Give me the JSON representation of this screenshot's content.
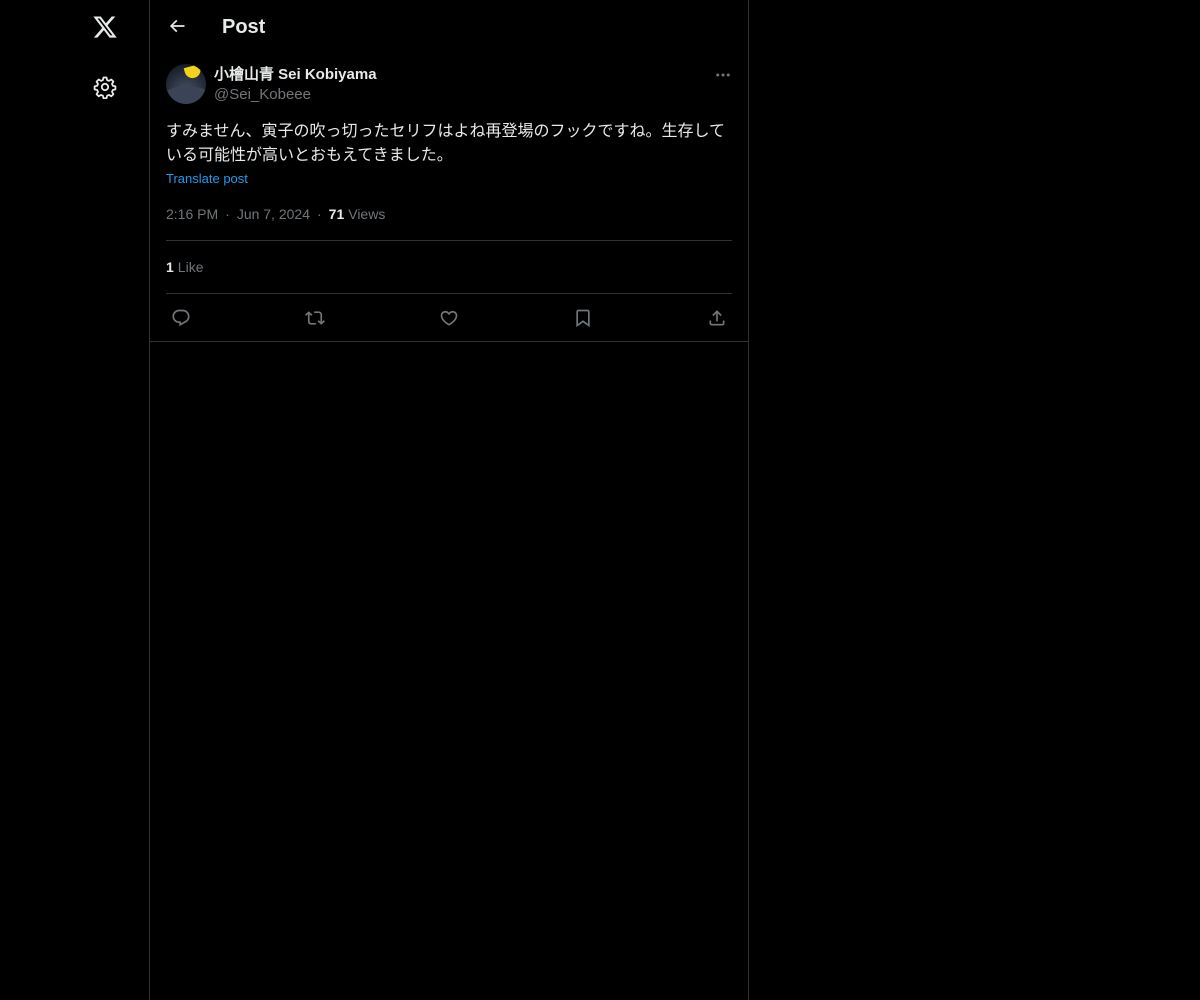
{
  "nav": {
    "logo_icon": "x-logo-icon",
    "settings_icon": "gear-icon"
  },
  "header": {
    "title": "Post",
    "back_icon": "arrow-left-icon"
  },
  "post": {
    "author_name": "小檜山青 Sei Kobiyama",
    "author_handle": "@Sei_Kobeee",
    "text": "すみません、寅子の吹っ切ったセリフはよね再登場のフックですね。生存している可能性が高いとおもえてきました。",
    "translate_label": "Translate post",
    "time": "2:16 PM",
    "date": "Jun 7, 2024",
    "separator": "·",
    "views_count": "71",
    "views_label": "Views",
    "likes_count": "1",
    "likes_label": "Like",
    "more_icon": "more-horizontal-icon"
  },
  "actions": [
    {
      "name": "reply-button",
      "icon": "reply-icon"
    },
    {
      "name": "repost-button",
      "icon": "repost-icon"
    },
    {
      "name": "like-button",
      "icon": "heart-icon"
    },
    {
      "name": "bookmark-button",
      "icon": "bookmark-icon"
    },
    {
      "name": "share-button",
      "icon": "share-icon"
    }
  ],
  "colors": {
    "background": "#000000",
    "text_primary": "#e7e9ea",
    "text_secondary": "#71767b",
    "link": "#1d9bf0",
    "border": "#2f3336",
    "avatar_moon": "#f2d21a"
  }
}
